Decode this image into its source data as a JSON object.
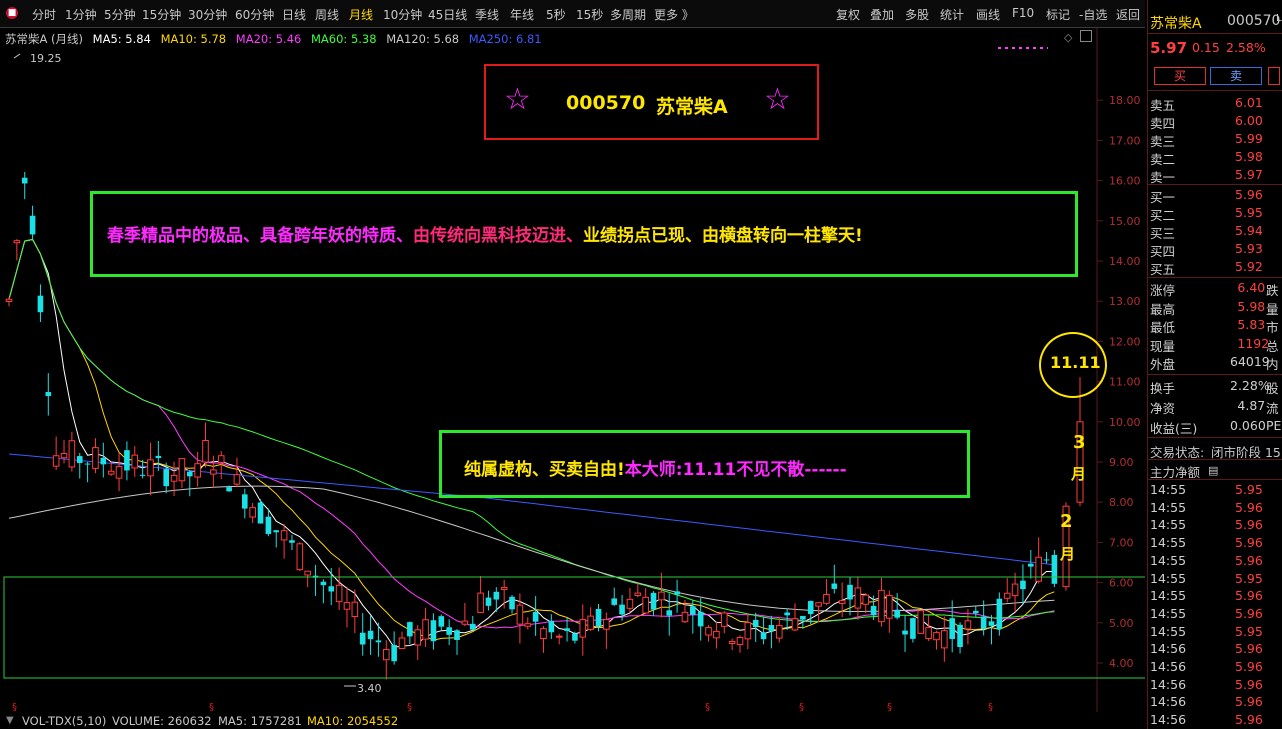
{
  "toolbar": {
    "periods": [
      "分时",
      "1分钟",
      "5分钟",
      "15分钟",
      "30分钟",
      "60分钟",
      "日线",
      "周线",
      "月线",
      "10分钟",
      "45日线",
      "季线",
      "年线",
      "5秒",
      "15秒",
      "多周期",
      "更多 》"
    ],
    "active_period": "月线",
    "right_buttons": [
      "复权",
      "叠加",
      "多股",
      "统计",
      "画线",
      "F10",
      "标记",
      "-自选",
      "返回"
    ]
  },
  "chart": {
    "title": "苏常柴A (月线)",
    "ma": [
      {
        "label": "MA5: 5.84",
        "color": "#ffffff"
      },
      {
        "label": "MA10: 5.78",
        "color": "#ffd700"
      },
      {
        "label": "MA20: 5.46",
        "color": "#ff3cff"
      },
      {
        "label": "MA60: 5.38",
        "color": "#3cff3c"
      },
      {
        "label": "MA120: 5.68",
        "color": "#c8c8c8"
      },
      {
        "label": "MA250: 6.81",
        "color": "#3c5aff"
      }
    ],
    "price_ticks": [
      "18.00",
      "17.00",
      "16.00",
      "15.00",
      "14.00",
      "13.00",
      "12.00",
      "11.00",
      "10.00",
      "9.00",
      "8.00",
      "7.00",
      "6.00",
      "5.00",
      "4.00"
    ],
    "high_label": "19.25",
    "low_label": "3.40",
    "annotation_title_code": "000570",
    "annotation_title_name": "苏常柴A",
    "annotation_slogan_1": "春季精品中的极品、具备跨年妖的特质、",
    "annotation_slogan_2": "由传统向黑科技迈进、",
    "annotation_slogan_3": "业绩拐点已现、由横盘转向一柱擎天!",
    "annotation_note_1": "纯属虚构、买卖自由!",
    "annotation_note_2": "本大师:11.11不见不散------",
    "target_label": "11.11",
    "month_3": "3",
    "month_3b": "月",
    "month_2": "2",
    "month_2b": "月",
    "chart_data": {
      "type": "candlestick",
      "title": "苏常柴A (月线)",
      "ylim": [
        3.4,
        19.25
      ],
      "high": 19.25,
      "low": 3.4,
      "last_close": 5.97
    }
  },
  "volume": {
    "label": "VOL-TDX(5,10)",
    "volume": "VOLUME: 260632",
    "ma5": "MA5: 1757281",
    "ma10": "MA10: 2054552"
  },
  "quote": {
    "name": "苏常柴A",
    "code": "000570",
    "price": "5.97",
    "change": "0.15",
    "pct": "2.58%",
    "buy_label": "买",
    "sell_label": "卖",
    "asks": [
      {
        "label": "卖五",
        "price": "6.01"
      },
      {
        "label": "卖四",
        "price": "6.00"
      },
      {
        "label": "卖三",
        "price": "5.99"
      },
      {
        "label": "卖二",
        "price": "5.98"
      },
      {
        "label": "卖一",
        "price": "5.97"
      }
    ],
    "bids": [
      {
        "label": "买一",
        "price": "5.96"
      },
      {
        "label": "买二",
        "price": "5.95"
      },
      {
        "label": "买三",
        "price": "5.94"
      },
      {
        "label": "买四",
        "price": "5.93"
      },
      {
        "label": "买五",
        "price": "5.92"
      }
    ],
    "stats": [
      {
        "label": "涨停",
        "value": "6.40",
        "extra": "跌"
      },
      {
        "label": "最高",
        "value": "5.98",
        "extra": "量"
      },
      {
        "label": "最低",
        "value": "5.83",
        "extra": "市"
      },
      {
        "label": "现量",
        "value": "1192",
        "extra": "总"
      },
      {
        "label": "外盘",
        "value": "64019",
        "extra": "内"
      },
      {
        "label": "换手",
        "value": "2.28%",
        "extra": "股"
      },
      {
        "label": "净资",
        "value": "4.87",
        "extra": "流"
      },
      {
        "label": "收益(三)",
        "value": "0.060",
        "extra": "PE"
      }
    ],
    "status_label": "交易状态:",
    "status_value": "闭市阶段 15",
    "netflow_label": "主力净额",
    "ticks": [
      {
        "time": "14:55",
        "price": "5.95"
      },
      {
        "time": "14:55",
        "price": "5.96"
      },
      {
        "time": "14:55",
        "price": "5.96"
      },
      {
        "time": "14:55",
        "price": "5.96"
      },
      {
        "time": "14:55",
        "price": "5.96"
      },
      {
        "time": "14:55",
        "price": "5.95"
      },
      {
        "time": "14:55",
        "price": "5.96"
      },
      {
        "time": "14:55",
        "price": "5.96"
      },
      {
        "time": "14:55",
        "price": "5.95"
      },
      {
        "time": "14:56",
        "price": "5.96"
      },
      {
        "time": "14:56",
        "price": "5.96"
      },
      {
        "time": "14:56",
        "price": "5.96"
      },
      {
        "time": "14:56",
        "price": "5.96"
      },
      {
        "time": "14:56",
        "price": "5.96"
      }
    ]
  }
}
